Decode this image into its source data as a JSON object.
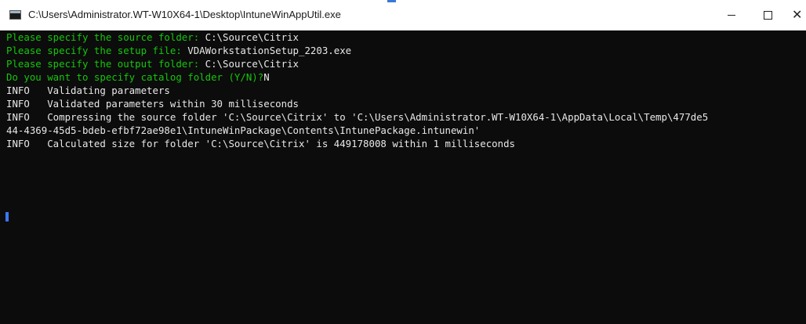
{
  "window": {
    "title": "C:\\Users\\Administrator.WT-W10X64-1\\Desktop\\IntuneWinAppUtil.exe",
    "controls": {
      "minimize_icon": "minimize-icon",
      "maximize_icon": "maximize-icon",
      "close_glyph": "✕"
    }
  },
  "colors": {
    "prompt_text": "#16c60c",
    "output_text": "#e8e8e8",
    "background": "#0c0c0c"
  },
  "console": {
    "prompts": [
      {
        "question": "Please specify the source folder: ",
        "answer": "C:\\Source\\Citrix"
      },
      {
        "question": "Please specify the setup file: ",
        "answer": "VDAWorkstationSetup_2203.exe"
      },
      {
        "question": "Please specify the output folder: ",
        "answer": "C:\\Source\\Citrix"
      },
      {
        "question": "Do you want to specify catalog folder (Y/N)?",
        "answer": "N"
      }
    ],
    "log": [
      "INFO   Validating parameters",
      "INFO   Validated parameters within 30 milliseconds",
      "INFO   Compressing the source folder 'C:\\Source\\Citrix' to 'C:\\Users\\Administrator.WT-W10X64-1\\AppData\\Local\\Temp\\477de5",
      "44-4369-45d5-bdeb-efbf72ae98e1\\IntuneWinPackage\\Contents\\IntunePackage.intunewin'",
      "INFO   Calculated size for folder 'C:\\Source\\Citrix' is 449178008 within 1 milliseconds"
    ]
  }
}
